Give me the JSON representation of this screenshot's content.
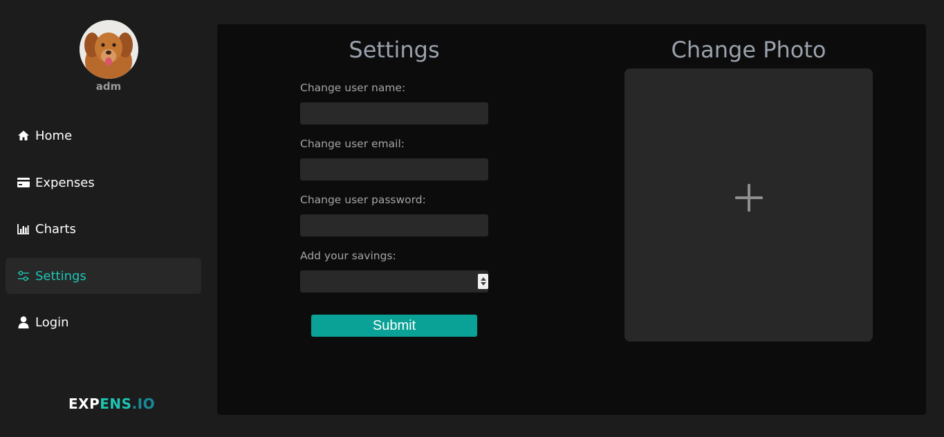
{
  "sidebar": {
    "username": "adm",
    "items": [
      {
        "label": "Home",
        "icon": "home-icon"
      },
      {
        "label": "Expenses",
        "icon": "credit-card-icon"
      },
      {
        "label": "Charts",
        "icon": "bar-chart-icon"
      },
      {
        "label": "Settings",
        "icon": "sliders-icon",
        "active": true
      },
      {
        "label": "Login",
        "icon": "user-icon"
      }
    ],
    "brand": {
      "part1": "EXP",
      "part2": "ENS",
      "part3": ".IO"
    }
  },
  "settings": {
    "title": "Settings",
    "fields": [
      {
        "label": "Change user name:",
        "value": ""
      },
      {
        "label": "Change user email:",
        "value": ""
      },
      {
        "label": "Change user password:",
        "value": ""
      },
      {
        "label": "Add your savings:",
        "value": ""
      }
    ],
    "submit_label": "Submit"
  },
  "photo": {
    "title": "Change Photo",
    "add_icon": "plus-icon"
  },
  "colors": {
    "accent": "#1ec5b3",
    "button": "#0aa296",
    "background": "#1c1c1c",
    "panel": "#0c0c0c"
  }
}
